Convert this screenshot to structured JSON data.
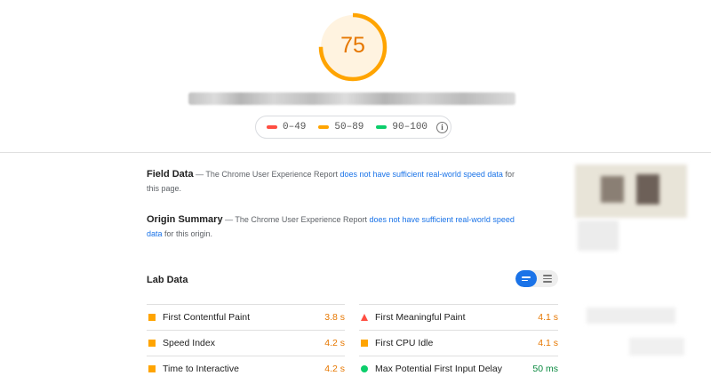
{
  "score": {
    "value": "75",
    "fraction": 0.75,
    "color": "#ffa400"
  },
  "url_text": "",
  "legend": [
    {
      "range": "0–49",
      "color": "#ff4e42"
    },
    {
      "range": "50–89",
      "color": "#ffa400"
    },
    {
      "range": "90–100",
      "color": "#0cce6b"
    }
  ],
  "legend_info_icon": "info-icon",
  "field_data": {
    "title": "Field Data",
    "text_before": " — The Chrome User Experience Report ",
    "link": "does not have sufficient real-world speed data",
    "text_after": " for this page."
  },
  "origin_summary": {
    "title": "Origin Summary",
    "text_before": " — The Chrome User Experience Report ",
    "link": "does not have sufficient real-world speed data",
    "text_after": " for this origin."
  },
  "lab_data": {
    "title": "Lab Data",
    "toggle_icons": [
      "list-view-icon",
      "detail-view-icon"
    ],
    "metrics_left": [
      {
        "label": "First Contentful Paint",
        "value": "3.8 s",
        "status": "average"
      },
      {
        "label": "Speed Index",
        "value": "4.2 s",
        "status": "average"
      },
      {
        "label": "Time to Interactive",
        "value": "4.2 s",
        "status": "average"
      }
    ],
    "metrics_right": [
      {
        "label": "First Meaningful Paint",
        "value": "4.1 s",
        "status": "fail"
      },
      {
        "label": "First CPU Idle",
        "value": "4.1 s",
        "status": "average"
      },
      {
        "label": "Max Potential First Input Delay",
        "value": "50 ms",
        "status": "pass"
      }
    ]
  },
  "colors": {
    "accent": "#1a73e8",
    "average": "#ffa400",
    "fail": "#ff4e42",
    "pass": "#0cce6b"
  }
}
